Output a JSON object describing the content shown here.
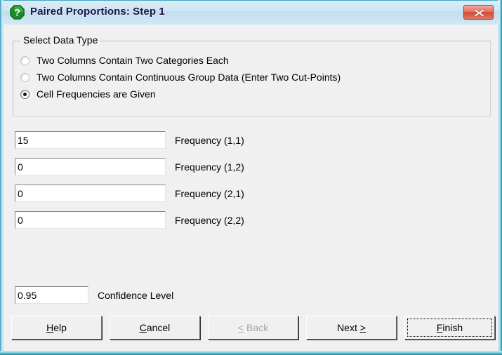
{
  "window": {
    "title": "Paired Proportions: Step 1",
    "icon": "question-mark-icon",
    "close_label": "✕",
    "accent_title_color": "#18174a",
    "close_button_color": "#cf4733"
  },
  "group": {
    "legend": "Select Data Type",
    "options": [
      {
        "label": "Two Columns Contain Two Categories Each",
        "checked": false
      },
      {
        "label": "Two Columns Contain Continuous Group Data (Enter Two Cut-Points)",
        "checked": false
      },
      {
        "label": "Cell Frequencies are Given",
        "checked": true
      }
    ]
  },
  "fields": [
    {
      "name": "frequency-1-1",
      "value": "15",
      "label": "Frequency (1,1)"
    },
    {
      "name": "frequency-1-2",
      "value": "0",
      "label": "Frequency (1,2)"
    },
    {
      "name": "frequency-2-1",
      "value": "0",
      "label": "Frequency (2,1)"
    },
    {
      "name": "frequency-2-2",
      "value": "0",
      "label": "Frequency (2,2)"
    }
  ],
  "confidence": {
    "value": "0.95",
    "label": "Confidence Level"
  },
  "buttons": {
    "help": {
      "prefix": "",
      "mnemonic": "H",
      "suffix": "elp",
      "enabled": true
    },
    "cancel": {
      "prefix": "",
      "mnemonic": "C",
      "suffix": "ancel",
      "enabled": true
    },
    "back": {
      "prefix": "",
      "mnemonic": "<",
      "suffix": " Back",
      "enabled": false
    },
    "next": {
      "prefix": "Next ",
      "mnemonic": ">",
      "suffix": "",
      "enabled": true
    },
    "finish": {
      "prefix": "",
      "mnemonic": "F",
      "suffix": "inish",
      "enabled": true,
      "focused": true
    }
  }
}
